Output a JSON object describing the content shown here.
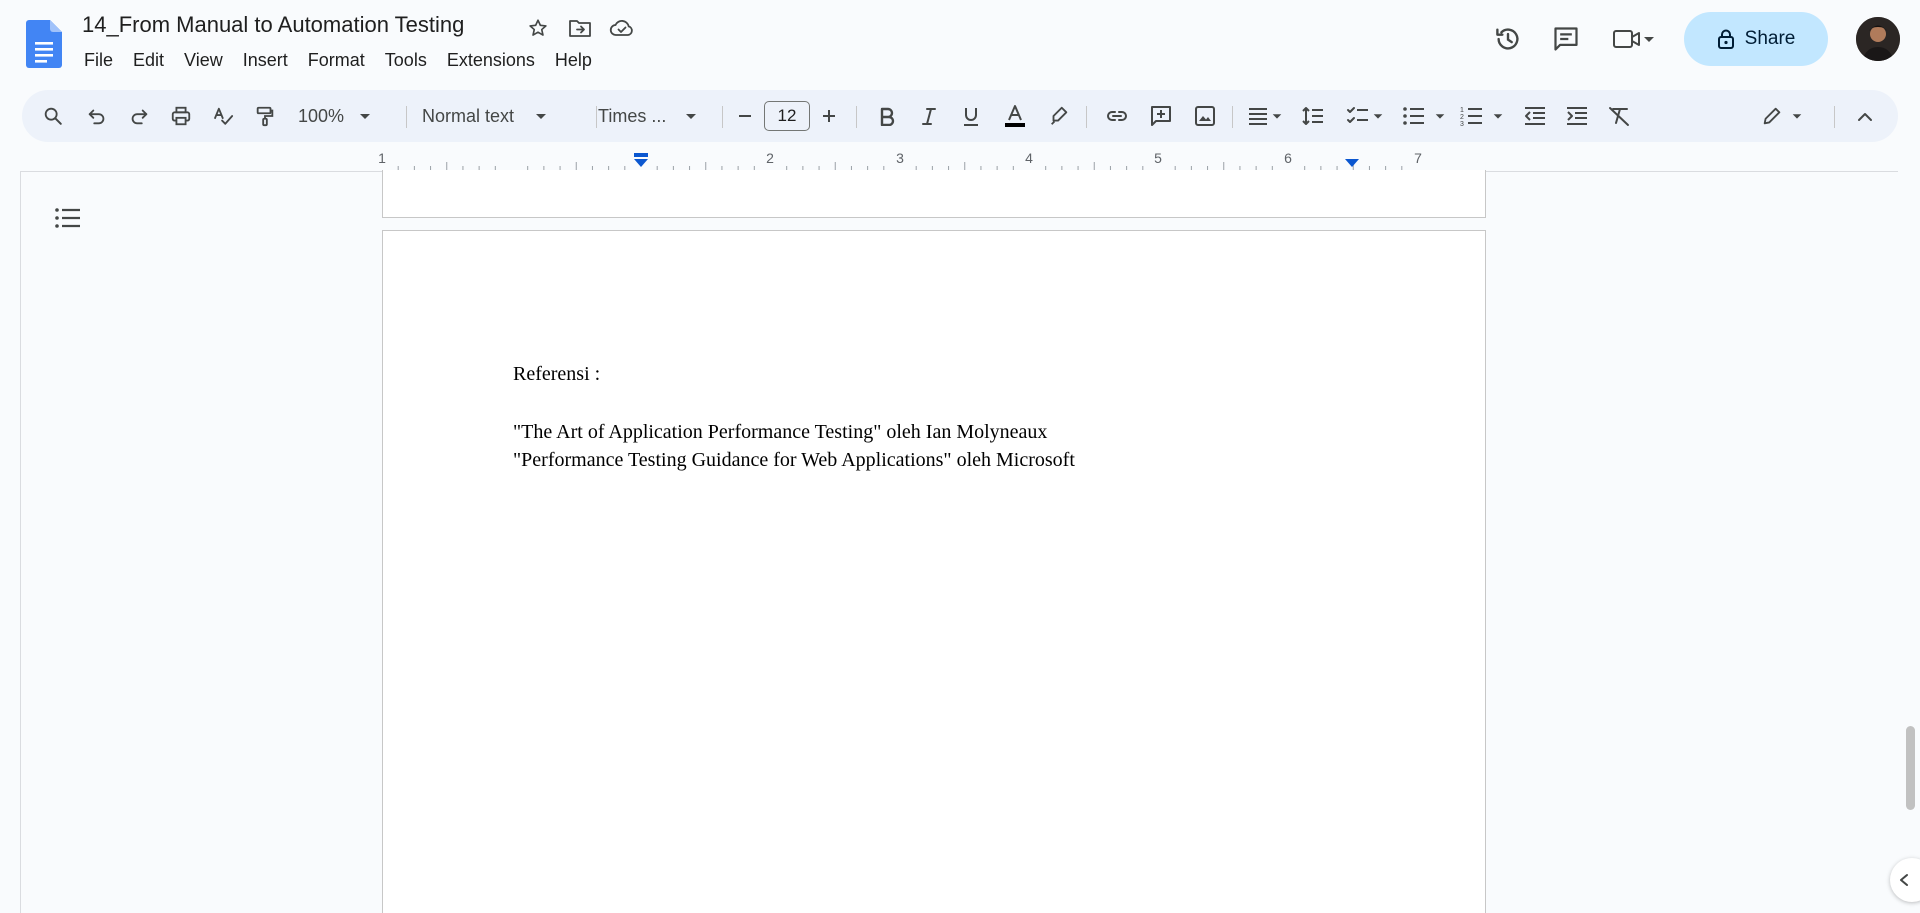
{
  "app": {
    "doc_title": "14_From Manual to Automation Testing",
    "accent_color": "#0b57d0",
    "share_bg": "#c2e7ff"
  },
  "menu": [
    "File",
    "Edit",
    "View",
    "Insert",
    "Format",
    "Tools",
    "Extensions",
    "Help"
  ],
  "header_actions": {
    "share_label": "Share"
  },
  "toolbar": {
    "zoom": "100%",
    "style": "Normal text",
    "font": "Times ...",
    "font_size": "12"
  },
  "ruler": {
    "numbers": [
      "1",
      "2",
      "3",
      "4",
      "5",
      "6",
      "7"
    ]
  },
  "document": {
    "heading": "Referensi :",
    "references": [
      "\"The Art of Application Performance Testing\" oleh Ian Molyneaux",
      "\"Performance Testing Guidance for Web Applications\" oleh Microsoft"
    ]
  }
}
